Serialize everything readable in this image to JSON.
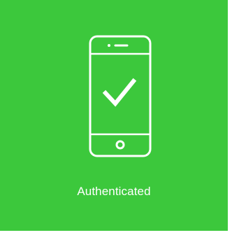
{
  "tile": {
    "background_color": "#3cc83c",
    "foreground_color": "#ffffff",
    "icon": "smartphone-checkmark-icon",
    "status_label": "Authenticated"
  }
}
